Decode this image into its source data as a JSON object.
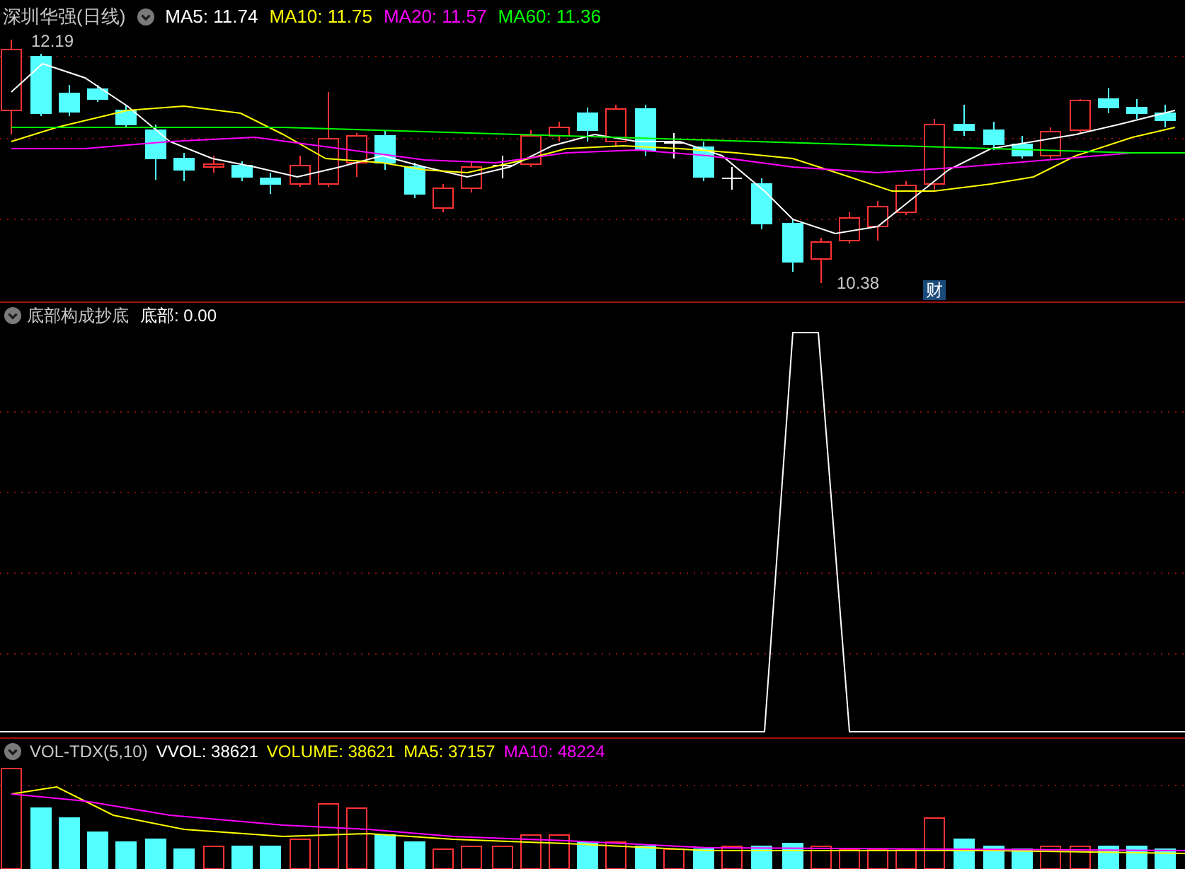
{
  "price_panel": {
    "title": "深圳华强(日线)",
    "indicators": [
      {
        "label": "MA5: 11.74",
        "color": "#ffffff"
      },
      {
        "label": "MA10: 11.75",
        "color": "#ffff00"
      },
      {
        "label": "MA20: 11.57",
        "color": "#ff00ff"
      },
      {
        "label": "MA60: 11.36",
        "color": "#00ff00"
      }
    ],
    "high_label": "12.19",
    "low_label": "10.38",
    "badge": "财"
  },
  "signal_panel": {
    "title": "底部构成抄底",
    "reading": "底部: 0.00"
  },
  "volume_panel": {
    "title": "VOL-TDX(5,10)",
    "indicators": [
      {
        "label": "VVOL: 38621",
        "color": "#ffffff"
      },
      {
        "label": "VOLUME: 38621",
        "color": "#ffff00"
      },
      {
        "label": "MA5: 37157",
        "color": "#ffff00"
      },
      {
        "label": "MA10: 48224",
        "color": "#ff00ff"
      }
    ]
  }
}
